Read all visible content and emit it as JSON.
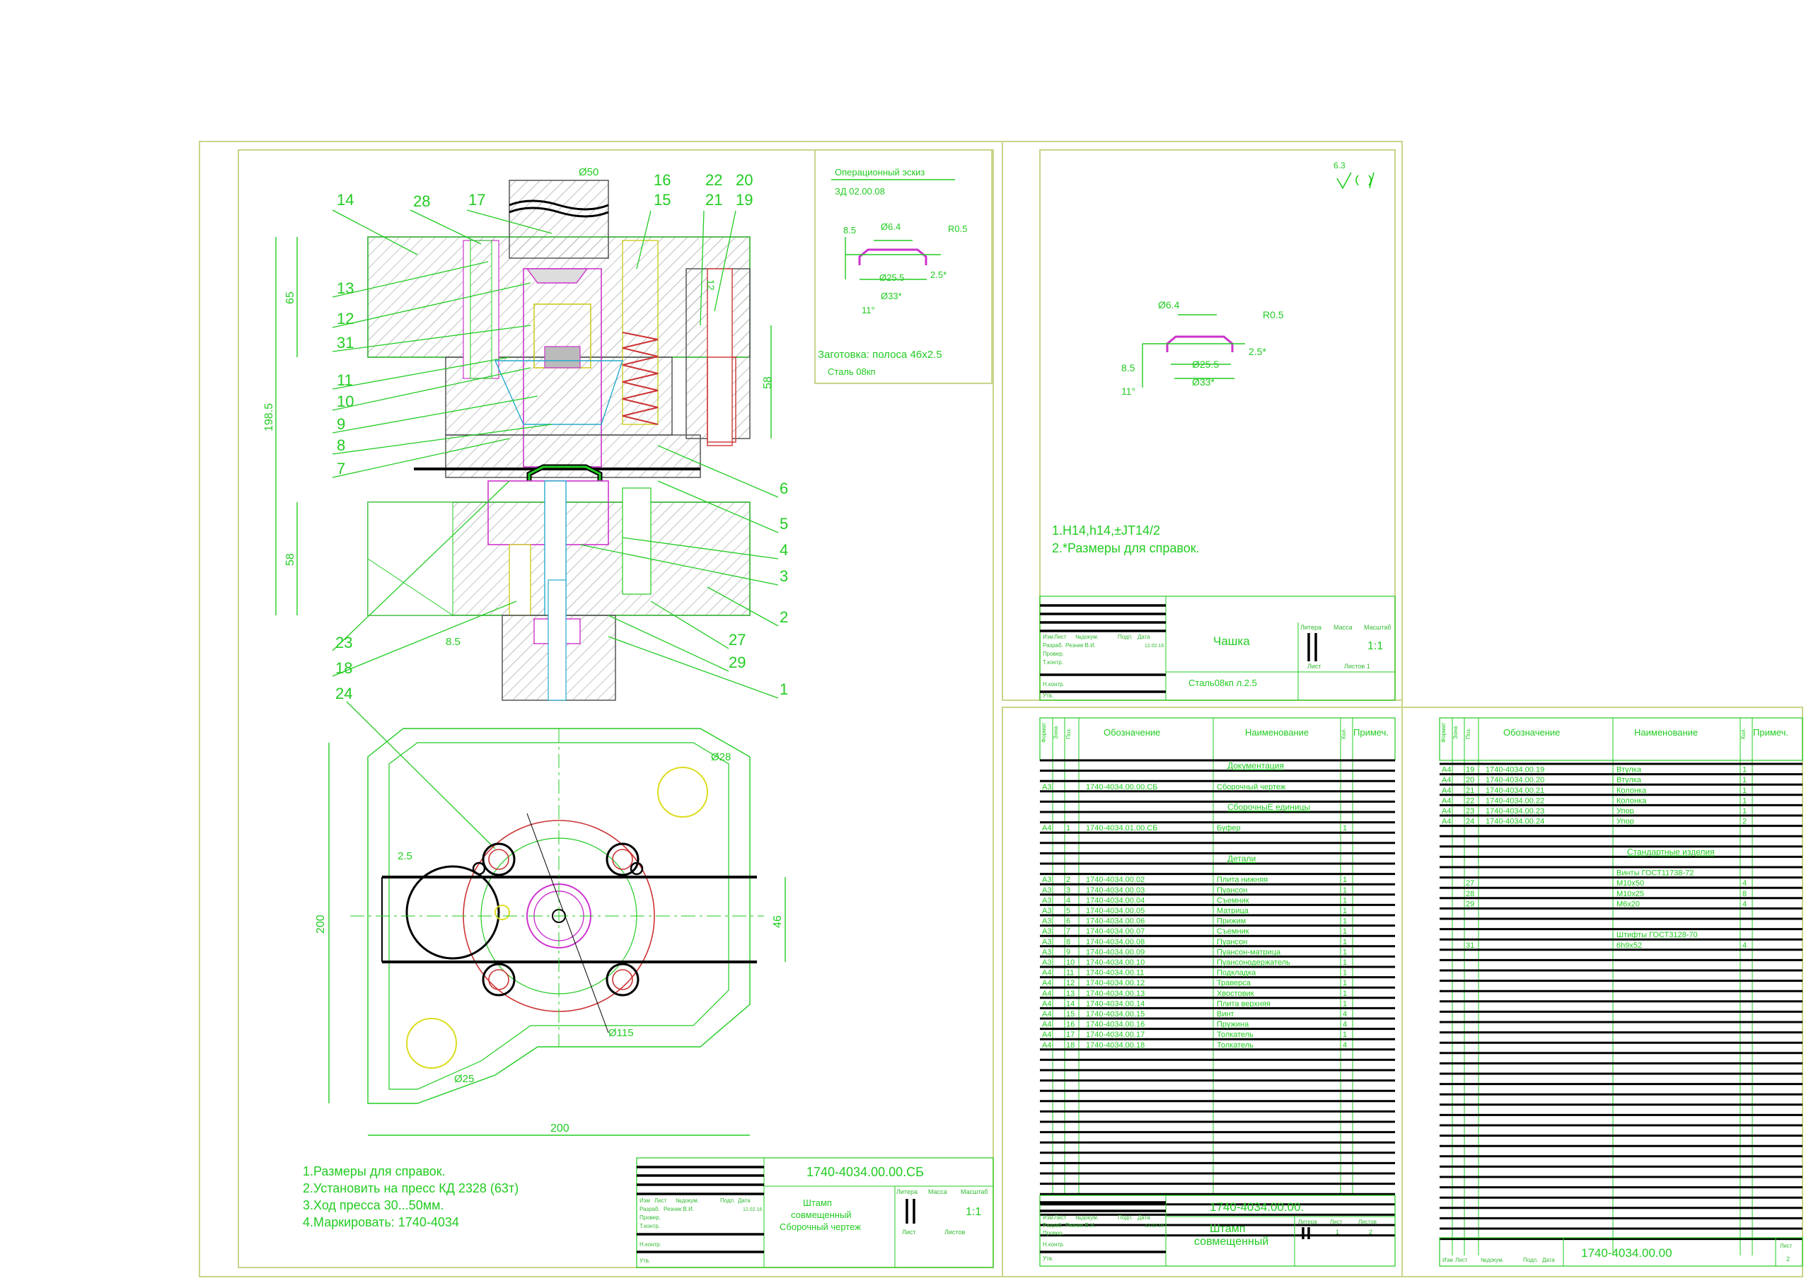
{
  "assembly": {
    "parts_labels": [
      "14",
      "28",
      "17",
      "Ø50",
      "16",
      "15",
      "22",
      "20",
      "21",
      "19",
      "13",
      "12",
      "31",
      "11",
      "10",
      "9",
      "8",
      "7",
      "6",
      "5",
      "4",
      "3",
      "2",
      "27",
      "29",
      "1",
      "23",
      "18",
      "24"
    ],
    "dim_65": "65",
    "dim_198_5": "198.5",
    "dim_58_left": "58",
    "dim_58_right": "58",
    "dim_8_5": "8.5",
    "dim_12": "12",
    "notes": [
      "1.Размеры для справок.",
      "2.Установить на пресс КД 2328 (63т)",
      "3.Ход пресса 30...50мм.",
      "4.Маркировать:  1740-4034"
    ]
  },
  "plan_view": {
    "d28": "Ø28",
    "d25": "Ø25",
    "d115": "Ø115",
    "dim_2_5": "2.5",
    "dim_200_v": "200",
    "dim_200_h": "200",
    "dim_46": "46"
  },
  "sketch": {
    "title": "Операционный эскиз",
    "code": "ЗД 02.00.08",
    "blank": "Заготовка: полоса 46х2.5",
    "material": "Сталь 08кп",
    "dims": {
      "d6_4": "Ø6.4",
      "r0_5": "R0.5",
      "d25_5": "Ø25.5",
      "d33": "Ø33*",
      "h8_5": "8.5",
      "a2_5": "2.5*",
      "ang11": "11°"
    }
  },
  "part_drawing": {
    "roughness": "6.3",
    "notes": [
      "1.H14,h14,±JT14/2",
      "2.*Размеры для справок."
    ],
    "name": "Чашка",
    "material": "Сталь08кп л.2.5",
    "scale": "1:1",
    "sheet": "Лист",
    "sheets": "Листов  1"
  },
  "assembly_title": {
    "code": "1740-4034.00.00.СБ",
    "name": "Штамп\nсовмещенный\nСборочный чертеж",
    "scale": "1:1"
  },
  "spec_headers": [
    "Формат",
    "Зона",
    "Поз.",
    "Обозначение",
    "Наименование",
    "Кол.",
    "Примеч."
  ],
  "spec1": [
    {
      "fmt": "",
      "pos": "",
      "code": "",
      "name": "Документация",
      "qty": "",
      "section": true
    },
    {
      "fmt": "А3",
      "pos": "",
      "code": "1740-4034.00.00.СБ",
      "name": "Сборочный чертеж",
      "qty": ""
    },
    {
      "fmt": "",
      "pos": "",
      "code": "",
      "name": "СборочныЕ единицы",
      "qty": "",
      "section": true
    },
    {
      "fmt": "А4",
      "pos": "1",
      "code": "1740-4034.01.00.СБ",
      "name": "Буфер",
      "qty": "1"
    },
    {
      "fmt": "",
      "pos": "",
      "code": "",
      "name": "Детали",
      "qty": "",
      "section": true
    },
    {
      "fmt": "А3",
      "pos": "2",
      "code": "1740-4034.00.02",
      "name": "Плита нижняя",
      "qty": "1"
    },
    {
      "fmt": "А3",
      "pos": "3",
      "code": "1740-4034.00.03",
      "name": "Пуансон",
      "qty": "1"
    },
    {
      "fmt": "А3",
      "pos": "4",
      "code": "1740-4034.00.04",
      "name": "Съемник",
      "qty": "1"
    },
    {
      "fmt": "А3",
      "pos": "5",
      "code": "1740-4034.00.05",
      "name": "Матрица",
      "qty": "1"
    },
    {
      "fmt": "А3",
      "pos": "6",
      "code": "1740-4034.00.06",
      "name": "Прижим",
      "qty": "1"
    },
    {
      "fmt": "А3",
      "pos": "7",
      "code": "1740-4034.00.07",
      "name": "Съемник",
      "qty": "1"
    },
    {
      "fmt": "А3",
      "pos": "8",
      "code": "1740-4034.00.08",
      "name": "Пуансон",
      "qty": "1"
    },
    {
      "fmt": "А3",
      "pos": "9",
      "code": "1740-4034.00.09",
      "name": "Пуансон-матрица",
      "qty": "1"
    },
    {
      "fmt": "А3",
      "pos": "10",
      "code": "1740-4034.00.10",
      "name": "Пуансонодержатель",
      "qty": "1"
    },
    {
      "fmt": "А4",
      "pos": "11",
      "code": "1740-4034.00.11",
      "name": "Подкладка",
      "qty": "1"
    },
    {
      "fmt": "А4",
      "pos": "12",
      "code": "1740-4034.00.12",
      "name": "Траверса",
      "qty": "1"
    },
    {
      "fmt": "А4",
      "pos": "13",
      "code": "1740-4034.00.13",
      "name": "Хвостовик",
      "qty": "1"
    },
    {
      "fmt": "А4",
      "pos": "14",
      "code": "1740-4034.00.14",
      "name": "Плита верхняя",
      "qty": "1"
    },
    {
      "fmt": "А4",
      "pos": "15",
      "code": "1740-4034.00.15",
      "name": "Винт",
      "qty": "4"
    },
    {
      "fmt": "А4",
      "pos": "16",
      "code": "1740-4034.00.16",
      "name": "Пружина",
      "qty": "4"
    },
    {
      "fmt": "А4",
      "pos": "17",
      "code": "1740-4034.00.17",
      "name": "Толкатель",
      "qty": "1"
    },
    {
      "fmt": "А4",
      "pos": "18",
      "code": "1740-4034.00.18",
      "name": "Толкатель",
      "qty": "4"
    }
  ],
  "spec1_title": {
    "code": "1740-4034.00.00.",
    "name": "Штамп\nсовмещенный",
    "sheet": "1",
    "sheets": "2"
  },
  "spec2": [
    {
      "fmt": "А4",
      "pos": "19",
      "code": "1740-4034.00.19",
      "name": "Втулка",
      "qty": "1"
    },
    {
      "fmt": "А4",
      "pos": "20",
      "code": "1740-4034.00.20",
      "name": "Втулка",
      "qty": "1"
    },
    {
      "fmt": "А4",
      "pos": "21",
      "code": "1740-4034.00.21",
      "name": "Колонка",
      "qty": "1"
    },
    {
      "fmt": "А4",
      "pos": "22",
      "code": "1740-4034.00.22",
      "name": "Колонка",
      "qty": "1"
    },
    {
      "fmt": "А4",
      "pos": "23",
      "code": "1740-4034.00.23",
      "name": "Упор",
      "qty": "1"
    },
    {
      "fmt": "А4",
      "pos": "24",
      "code": "1740-4034.00.24",
      "name": "Упор",
      "qty": "2"
    },
    {
      "fmt": "",
      "pos": "",
      "code": "",
      "name": "Стандартные изделия",
      "qty": "",
      "section": true
    },
    {
      "fmt": "",
      "pos": "",
      "code": "",
      "name": "Винты ГОСТ11738-72",
      "qty": ""
    },
    {
      "fmt": "",
      "pos": "27",
      "code": "",
      "name": "М10х50",
      "qty": "4"
    },
    {
      "fmt": "",
      "pos": "28",
      "code": "",
      "name": "М10х25",
      "qty": "8"
    },
    {
      "fmt": "",
      "pos": "29",
      "code": "",
      "name": "М6х20",
      "qty": "4"
    },
    {
      "fmt": "",
      "pos": "",
      "code": "",
      "name": "Штифты ГОСТ3128-70",
      "qty": ""
    },
    {
      "fmt": "",
      "pos": "31",
      "code": "",
      "name": "6h9х52",
      "qty": "4"
    }
  ],
  "spec2_title": {
    "code": "1740-4034.00.00",
    "sheet": "2"
  },
  "stamp_labels": {
    "izm": "Изм",
    "list": "Лист",
    "ndok": "№докум.",
    "podp": "Подп.",
    "data": "Дата",
    "razrab": "Разраб.",
    "author": "Резник В.И.",
    "date": "12.02.16",
    "prov": "Провер.",
    "tkontr": "Т.контр.",
    "nkontr": "Н.контр.",
    "utv": "Утв.",
    "litera": "Литера",
    "massa": "Масса",
    "masshtab": "Масштаб",
    "listov": "Листов"
  },
  "colors": {
    "frame": "#c8d58a",
    "line": "#22cc22",
    "section": "#000000",
    "accent_red": "#cc3333",
    "accent_magenta": "#cc33cc",
    "accent_cyan": "#22aacc",
    "accent_yellow": "#dddd22"
  }
}
